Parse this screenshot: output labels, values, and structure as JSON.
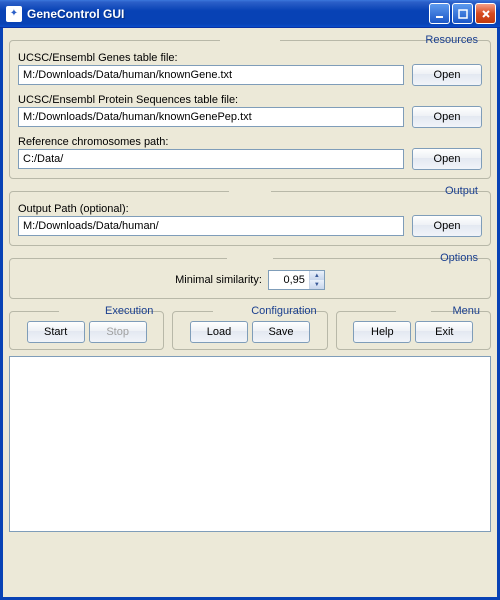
{
  "window": {
    "title": "GeneControl GUI"
  },
  "resources": {
    "legend": "Resources",
    "genes_label": "UCSC/Ensembl Genes table file:",
    "genes_value": "M:/Downloads/Data/human/knownGene.txt",
    "protein_label": "UCSC/Ensembl Protein Sequences table file:",
    "protein_value": "M:/Downloads/Data/human/knownGenePep.txt",
    "chrom_label": "Reference chromosomes path:",
    "chrom_value": "C:/Data/",
    "open_label": "Open"
  },
  "output": {
    "legend": "Output",
    "path_label": "Output Path (optional):",
    "path_value": "M:/Downloads/Data/human/",
    "open_label": "Open"
  },
  "options": {
    "legend": "Options",
    "similarity_label": "Minimal similarity:",
    "similarity_value": "0,95"
  },
  "execution": {
    "legend": "Execution",
    "start_label": "Start",
    "stop_label": "Stop"
  },
  "configuration": {
    "legend": "Configuration",
    "load_label": "Load",
    "save_label": "Save"
  },
  "menu": {
    "legend": "Menu",
    "help_label": "Help",
    "exit_label": "Exit"
  },
  "log": {
    "value": ""
  }
}
